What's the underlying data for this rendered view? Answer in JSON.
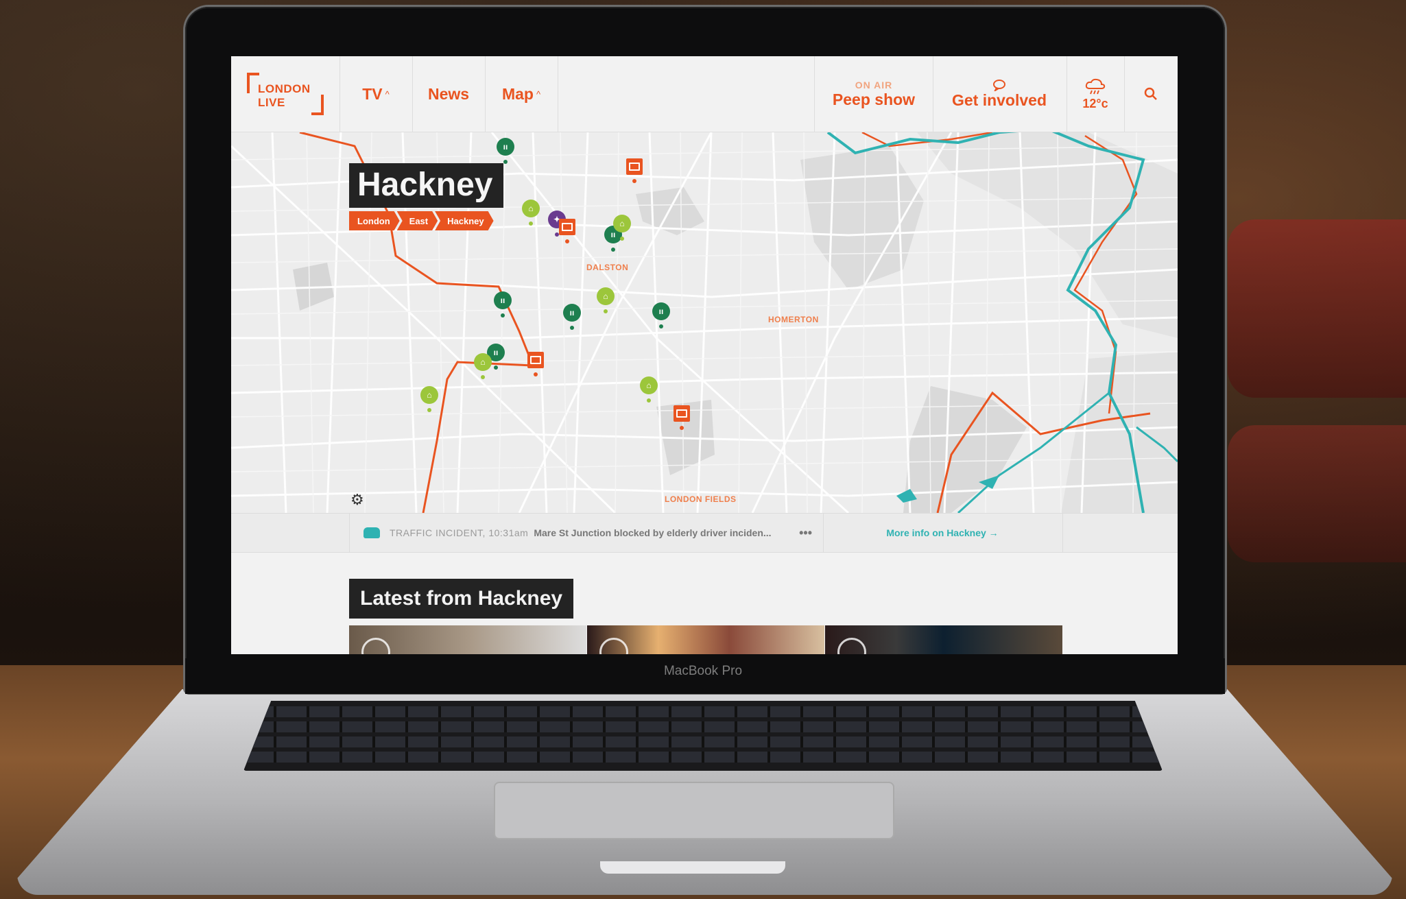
{
  "device": {
    "brand": "MacBook Pro"
  },
  "nav": {
    "logo_line1": "LONDON",
    "logo_line2": "LIVE",
    "tv": "TV",
    "news": "News",
    "map": "Map",
    "onair_label": "ON AIR",
    "onair_show": "Peep show",
    "get_involved": "Get involved",
    "temperature": "12°c"
  },
  "map": {
    "title": "Hackney",
    "breadcrumbs": [
      "London",
      "East",
      "Hackney"
    ],
    "labels": [
      "DALSTON",
      "HOMERTON",
      "LONDON FIELDS"
    ]
  },
  "ticker": {
    "label": "TRAFFIC INCIDENT, 10:31am",
    "text": "Mare St Junction blocked by elderly driver inciden...",
    "more": "More info on Hackney →"
  },
  "latest": {
    "title": "Latest from Hackney"
  },
  "colors": {
    "accent": "#e95420",
    "teal": "#2fb2b2",
    "pin_food": "#1e7f4f",
    "pin_culture": "#9cc63b",
    "pin_twitter": "#6a3b8f",
    "dark": "#232323"
  },
  "markers": [
    {
      "type": "food"
    },
    {
      "type": "media"
    },
    {
      "type": "culture"
    },
    {
      "type": "twitter"
    },
    {
      "type": "media"
    },
    {
      "type": "food"
    },
    {
      "type": "culture"
    },
    {
      "type": "food"
    },
    {
      "type": "culture"
    },
    {
      "type": "food"
    },
    {
      "type": "food"
    },
    {
      "type": "food"
    },
    {
      "type": "culture"
    },
    {
      "type": "media"
    },
    {
      "type": "culture"
    },
    {
      "type": "culture"
    },
    {
      "type": "media"
    }
  ]
}
